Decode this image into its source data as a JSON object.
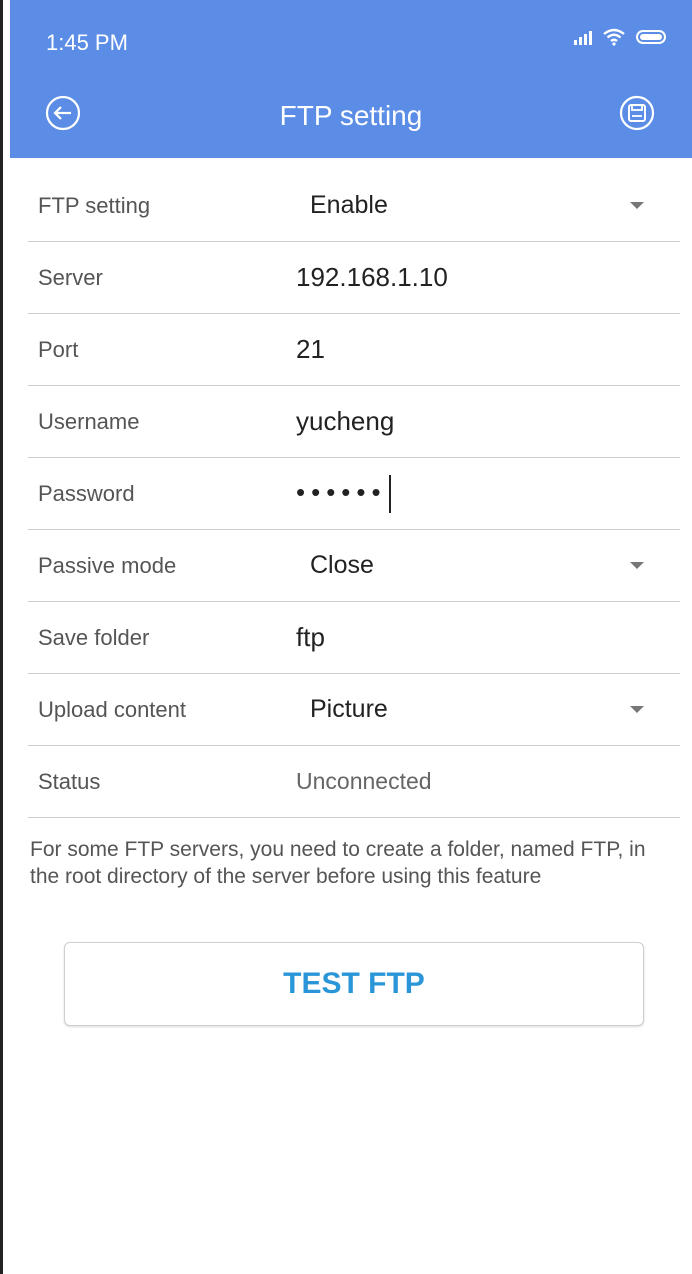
{
  "status_bar": {
    "time": "1:45 PM",
    "icons": [
      "signal-icon",
      "wifi-icon",
      "battery-icon"
    ]
  },
  "header": {
    "title": "FTP setting",
    "back_icon": "back-arrow-icon",
    "save_icon": "save-icon",
    "background_color": "#5b8de6"
  },
  "form": {
    "ftp_setting": {
      "label": "FTP setting",
      "value": "Enable"
    },
    "server": {
      "label": "Server",
      "value": "192.168.1.10"
    },
    "port": {
      "label": "Port",
      "value": "21"
    },
    "username": {
      "label": "Username",
      "value": "yucheng"
    },
    "password": {
      "label": "Password",
      "value": "••••••"
    },
    "passive_mode": {
      "label": "Passive mode",
      "value": "Close"
    },
    "save_folder": {
      "label": "Save folder",
      "value": "ftp"
    },
    "upload_content": {
      "label": "Upload content",
      "value": "Picture"
    },
    "status": {
      "label": "Status",
      "value": "Unconnected"
    }
  },
  "note": "For some FTP servers, you need to create a folder, named FTP, in the root directory of the server before using this feature",
  "test_button": {
    "label": "TEST FTP",
    "color": "#2a96d8"
  }
}
